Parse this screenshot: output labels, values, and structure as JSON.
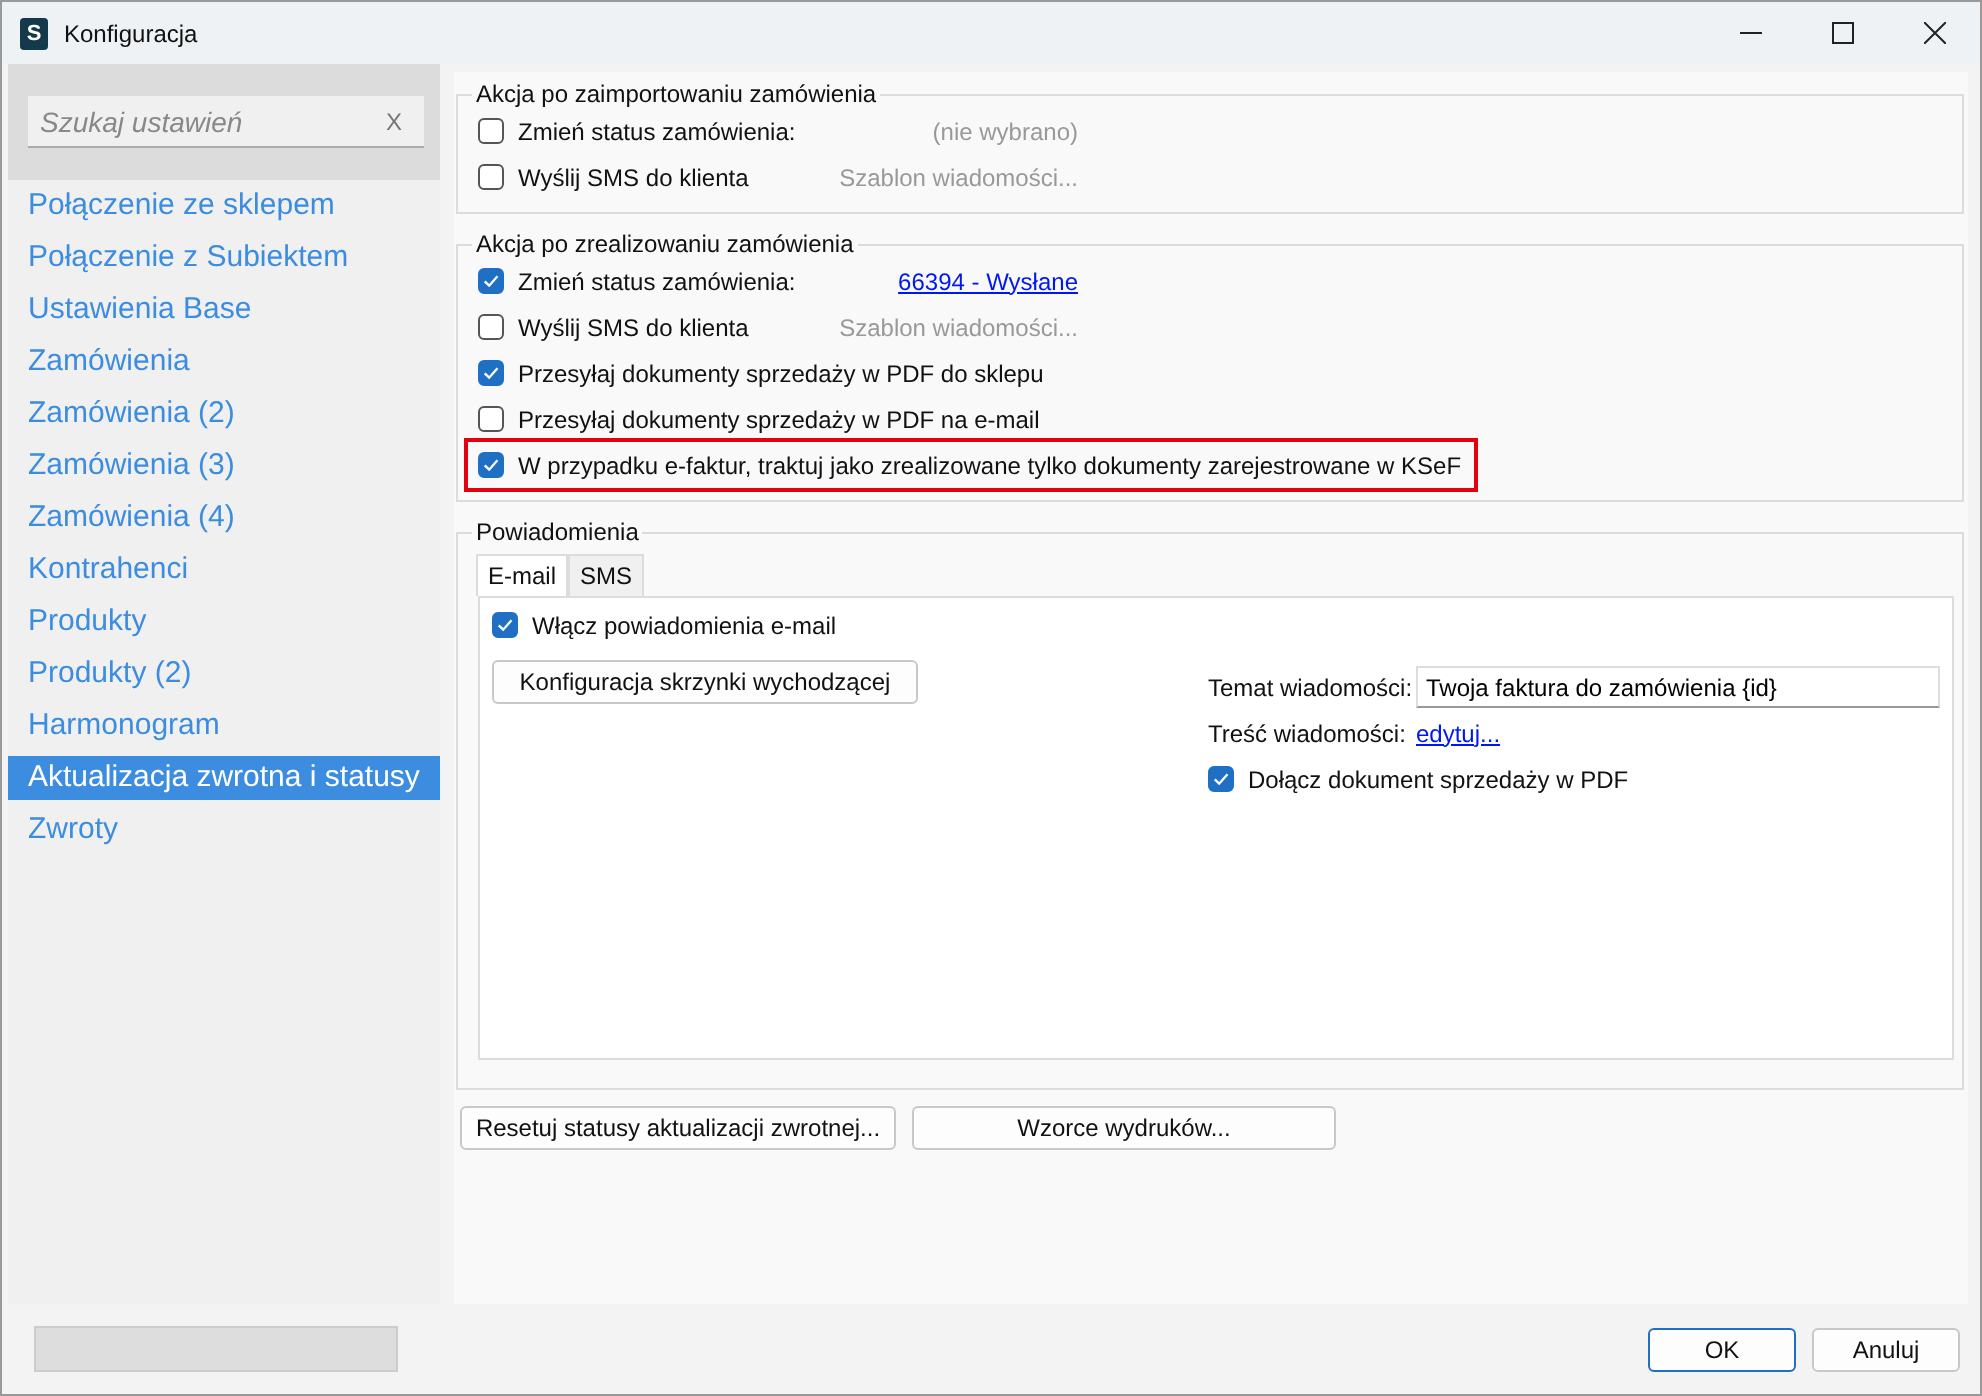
{
  "window": {
    "title": "Konfiguracja",
    "icon_letter": "S"
  },
  "progress": {
    "level": 0
  },
  "search": {
    "placeholder": "Szukaj ustawień",
    "clear": "X"
  },
  "sidebar": {
    "items": [
      {
        "label": "Połączenie ze sklepem",
        "selected": false
      },
      {
        "label": "Połączenie z Subiektem",
        "selected": false
      },
      {
        "label": "Ustawienia Base",
        "selected": false
      },
      {
        "label": "Zamówienia",
        "selected": false
      },
      {
        "label": "Zamówienia (2)",
        "selected": false
      },
      {
        "label": "Zamówienia (3)",
        "selected": false
      },
      {
        "label": "Zamówienia (4)",
        "selected": false
      },
      {
        "label": "Kontrahenci",
        "selected": false
      },
      {
        "label": "Produkty",
        "selected": false
      },
      {
        "label": "Produkty (2)",
        "selected": false
      },
      {
        "label": "Harmonogram",
        "selected": false
      },
      {
        "label": "Aktualizacja zwrotna i statusy",
        "selected": true
      },
      {
        "label": "Zwroty",
        "selected": false
      }
    ]
  },
  "groups": [
    {
      "title": "Akcja po zaimportowaniu zamówienia",
      "rows": [
        {
          "label": "Zmień status zamówienia:",
          "checked": false,
          "highlighted": false,
          "value": "(nie wybrano)",
          "kind": "hint"
        },
        {
          "label": "Wyślij SMS do klienta",
          "checked": false,
          "highlighted": false,
          "value": "Szablon wiadomości...",
          "kind": "hint"
        }
      ]
    },
    {
      "title": "Akcja po zrealizowaniu zamówienia",
      "rows": [
        {
          "label": "Zmień status zamówienia:",
          "checked": true,
          "highlighted": false,
          "value": "66394 - Wysłane",
          "kind": "link"
        },
        {
          "label": "Wyślij SMS do klienta",
          "checked": false,
          "highlighted": false,
          "value": "Szablon wiadomości...",
          "kind": "hint"
        },
        {
          "label": "Przesyłaj dokumenty sprzedaży w PDF do sklepu",
          "checked": true,
          "highlighted": false
        },
        {
          "label": "Przesyłaj dokumenty sprzedaży w PDF na e-mail",
          "checked": false,
          "highlighted": false
        },
        {
          "label": "W przypadku e-faktur, traktuj jako zrealizowane tylko dokumenty zarejestrowane w KSeF",
          "checked": true,
          "highlighted": true
        }
      ]
    }
  ],
  "notifications": {
    "title": "Powiadomienia",
    "tabs": [
      {
        "label": "E-mail",
        "selected": true
      },
      {
        "label": "SMS",
        "selected": false
      }
    ],
    "enable": {
      "label": "Włącz powiadomienia e-mail",
      "checked": true
    },
    "outbox_button": "Konfiguracja skrzynki wychodzącej",
    "subject_label": "Temat wiadomości:",
    "subject_value": "Twoja faktura do zamówienia {id}",
    "body_label": "Treść wiadomości:",
    "body_link": "edytuj...",
    "attach": {
      "label": "Dołącz dokument sprzedaży w PDF",
      "checked": true
    }
  },
  "actions": [
    "Resetuj statusy aktualizacji zwrotnej...",
    "Wzorce wydruków..."
  ],
  "buttons": [
    "OK",
    "Anuluj"
  ]
}
